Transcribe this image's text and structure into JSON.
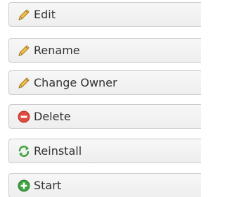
{
  "menu": {
    "items": [
      {
        "label": "Edit",
        "icon": "pencil-icon"
      },
      {
        "label": "Rename",
        "icon": "pencil-icon"
      },
      {
        "label": "Change Owner",
        "icon": "pencil-icon"
      },
      {
        "label": "Delete",
        "icon": "delete-icon",
        "icon_color": "#e04b3f"
      },
      {
        "label": "Reinstall",
        "icon": "reinstall-icon",
        "icon_color": "#3fa43f"
      },
      {
        "label": "Start",
        "icon": "start-icon",
        "icon_color": "#3fa43f"
      }
    ]
  }
}
